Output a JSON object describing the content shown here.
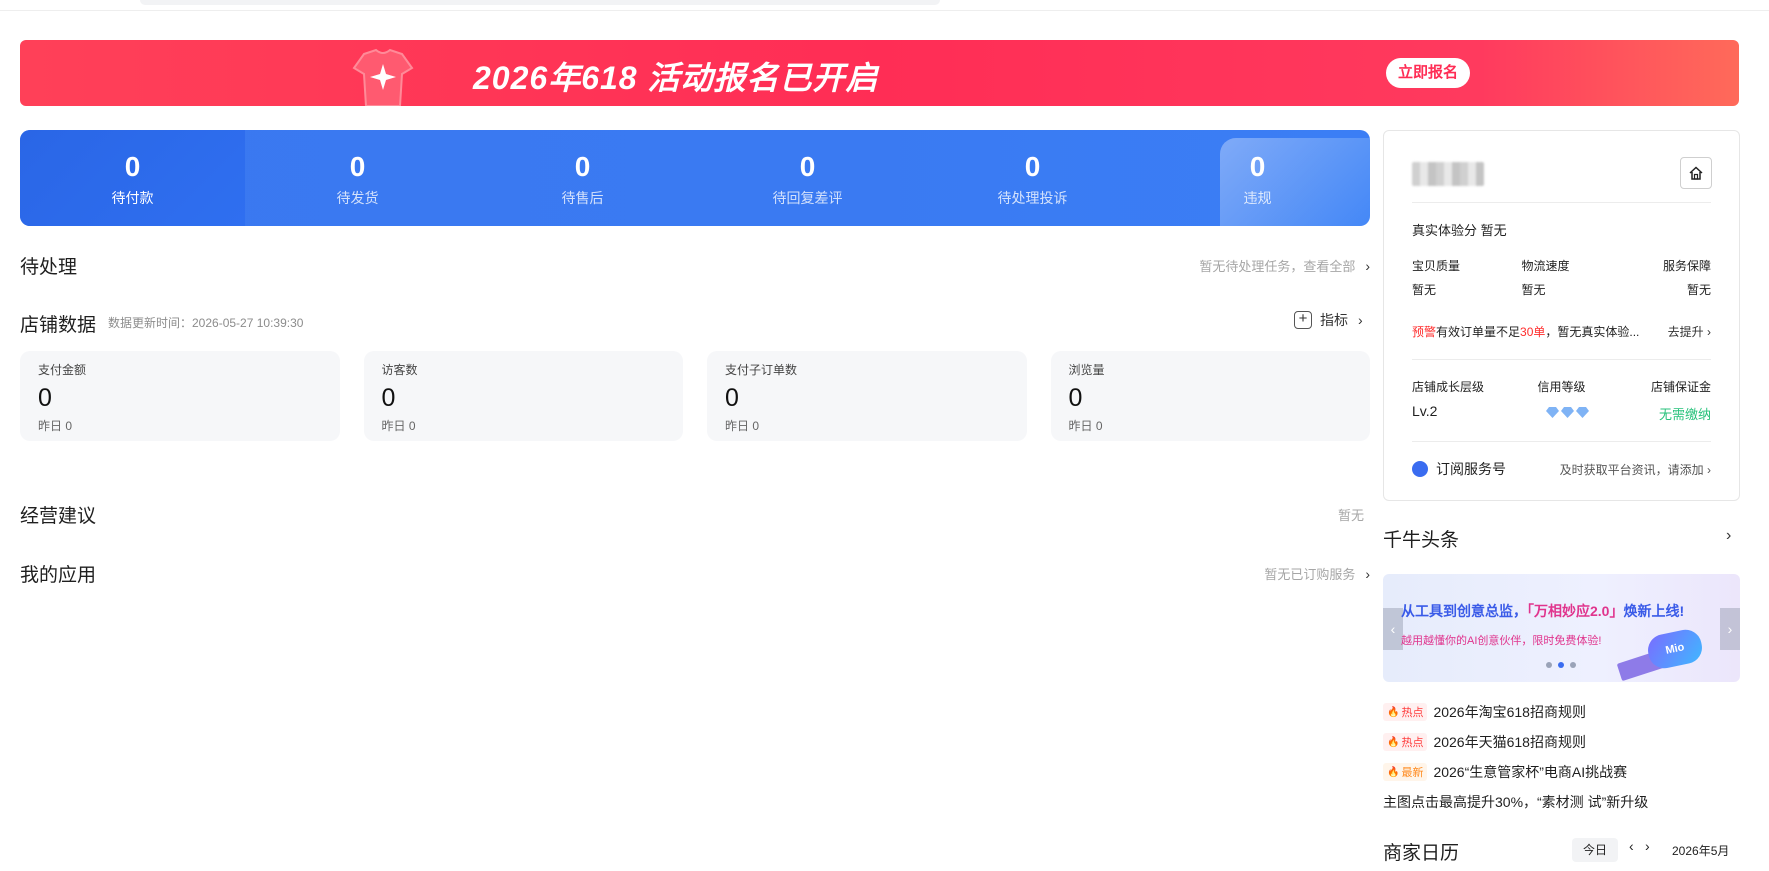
{
  "banner": {
    "title": "2026年618 活动报名已开启",
    "button": "立即报名"
  },
  "orders": [
    {
      "count": "0",
      "label": "待付款"
    },
    {
      "count": "0",
      "label": "待发货"
    },
    {
      "count": "0",
      "label": "待售后"
    },
    {
      "count": "0",
      "label": "待回复差评"
    },
    {
      "count": "0",
      "label": "待处理投诉"
    },
    {
      "count": "0",
      "label": "违规"
    }
  ],
  "pending": {
    "title": "待处理",
    "right": "暂无待处理任务，查看全部"
  },
  "store_data": {
    "title": "店铺数据",
    "update_time": "数据更新时间：2026-05-27 10:39:30",
    "metric_link": "指标",
    "cards": [
      {
        "label": "支付金额",
        "value": "0",
        "yesterday": "昨日  0"
      },
      {
        "label": "访客数",
        "value": "0",
        "yesterday": "昨日  0"
      },
      {
        "label": "支付子订单数",
        "value": "0",
        "yesterday": "昨日  0"
      },
      {
        "label": "浏览量",
        "value": "0",
        "yesterday": "昨日  0"
      }
    ]
  },
  "advice": {
    "title": "经营建议",
    "right": "暂无"
  },
  "apps": {
    "title": "我的应用",
    "right": "暂无已订购服务"
  },
  "store_panel": {
    "experience_score": "真实体验分  暂无",
    "exp_labels": [
      "宝贝质量",
      "物流速度",
      "服务保障"
    ],
    "exp_values": [
      "暂无",
      "暂无",
      "暂无"
    ],
    "warn_tag": "预警",
    "warn_text_1": "有效订单量不足",
    "warn_red": "30单",
    "warn_text_2": "，暂无真实体验...",
    "warn_action": "去提升",
    "growth_labels": [
      "店铺成长层级",
      "信用等级",
      "店铺保证金"
    ],
    "level": "Lv.2",
    "deposit": "无需缴纳",
    "subscribe_label": "订阅服务号",
    "subscribe_hint": "及时获取平台资讯，请添加"
  },
  "qianniu": {
    "title": "千牛头条",
    "banner_headline_1": "从工具到创意总监，",
    "banner_headline_2": "「万相妙应2.0」",
    "banner_headline_3": "焕新上线!",
    "banner_sub": "越用越懂你的AI创意伙伴，限时免费体验!",
    "banner_mascot": "Mio",
    "news": [
      {
        "tag": "热点",
        "text": "2026年淘宝618招商规则"
      },
      {
        "tag": "热点",
        "text": "2026年天猫618招商规则"
      },
      {
        "tag": "最新",
        "text": "2026“生意管家杯”电商AI挑战赛"
      },
      {
        "tag": "",
        "text": "主图点击最高提升30%，“素材测 试”新升级"
      }
    ]
  },
  "calendar": {
    "title": "商家日历",
    "today": "今日",
    "month": "2026年5月"
  }
}
